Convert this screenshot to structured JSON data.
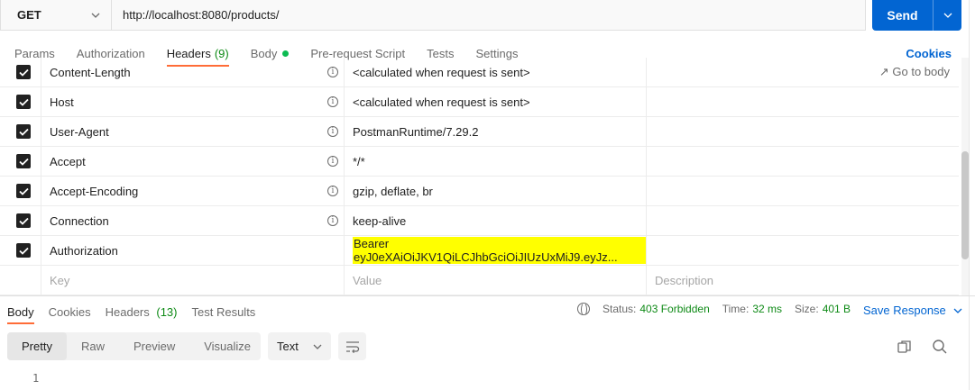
{
  "request": {
    "method": "GET",
    "url": "http://localhost:8080/products/",
    "send_label": "Send"
  },
  "request_tabs": [
    {
      "label": "Params"
    },
    {
      "label": "Authorization"
    },
    {
      "label": "Headers",
      "count": "(9)"
    },
    {
      "label": "Body"
    },
    {
      "label": "Pre-request Script"
    },
    {
      "label": "Tests"
    },
    {
      "label": "Settings"
    }
  ],
  "cookies_label": "Cookies",
  "go_to_body": "Go to body",
  "headers": [
    {
      "key": "Content-Length",
      "value": "<calculated when request is sent>"
    },
    {
      "key": "Host",
      "value": "<calculated when request is sent>"
    },
    {
      "key": "User-Agent",
      "value": "PostmanRuntime/7.29.2"
    },
    {
      "key": "Accept",
      "value": "*/*"
    },
    {
      "key": "Accept-Encoding",
      "value": "gzip, deflate, br"
    },
    {
      "key": "Connection",
      "value": "keep-alive"
    },
    {
      "key": "Authorization",
      "value": "Bearer eyJ0eXAiOiJKV1QiLCJhbGciOiJIUzUxMiJ9.eyJz..."
    }
  ],
  "empty_row": {
    "key": "Key",
    "value": "Value",
    "description": "Description"
  },
  "response_tabs": [
    {
      "label": "Body"
    },
    {
      "label": "Cookies"
    },
    {
      "label": "Headers",
      "count": "(13)"
    },
    {
      "label": "Test Results"
    }
  ],
  "status": {
    "status_label": "Status:",
    "status_value": "403 Forbidden",
    "time_label": "Time:",
    "time_value": "32 ms",
    "size_label": "Size:",
    "size_value": "401 B"
  },
  "save_response": "Save Response",
  "format_options": [
    "Pretty",
    "Raw",
    "Preview",
    "Visualize"
  ],
  "text_format": "Text",
  "line_number": "1",
  "colors": {
    "accent": "#ff6c37",
    "send": "#0265d2",
    "highlight": "#ffff00",
    "success": "#0e8a16"
  }
}
